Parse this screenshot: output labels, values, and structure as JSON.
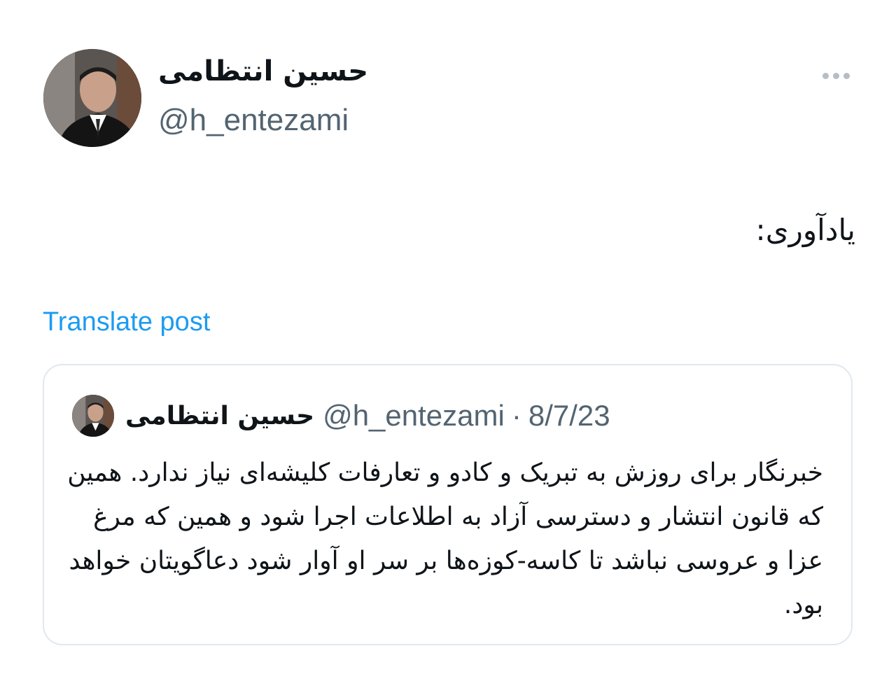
{
  "author": {
    "display_name": "حسین انتظامی",
    "handle": "@h_entezami",
    "avatar_icon": "profile-photo"
  },
  "menu": {
    "icon": "more-horizontal-icon"
  },
  "post": {
    "text": "یادآوری:",
    "translate_label": "Translate post"
  },
  "quote": {
    "display_name": "حسین انتظامی",
    "handle": "@h_entezami",
    "separator": "·",
    "date": "8/7/23",
    "text": "خبرنگار برای روزش به تبریک و کادو و تعارفات کلیشه‌ای نیاز ندارد. همین که قانون انتشار و دسترسی آزاد به اطلاعات اجرا شود و همین که مرغ عزا و عروسی نباشد تا کاسه-کوزه‌ها بر سر او آوار شود دعاگویتان خواهد بود."
  },
  "colors": {
    "text_primary": "#0f1419",
    "text_secondary": "#536471",
    "link": "#1d9bf0",
    "border": "#e1e8ed"
  }
}
